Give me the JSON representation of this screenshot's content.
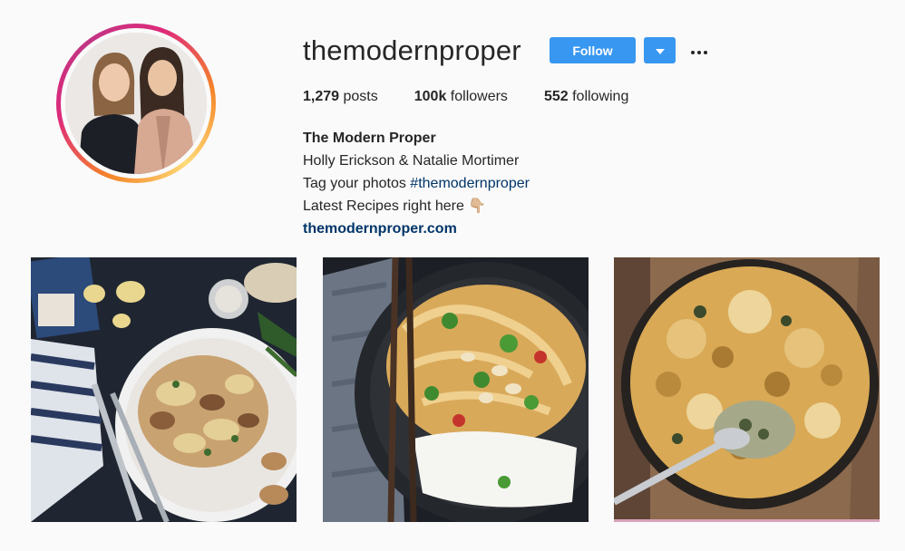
{
  "profile": {
    "username": "themodernproper",
    "follow_label": "Follow",
    "stats": {
      "posts_count": "1,279",
      "posts_label": "posts",
      "followers_count": "100k",
      "followers_label": "followers",
      "following_count": "552",
      "following_label": "following"
    },
    "bio": {
      "name": "The Modern Proper",
      "line1": "Holly Erickson & Natalie Mortimer",
      "line2_prefix": "Tag your photos ",
      "line2_hashtag": "#themodernproper",
      "line3": "Latest Recipes right here 👇🏼",
      "website": "themodernproper.com"
    }
  },
  "icons": {
    "dropdown": "chevron-down-icon",
    "more": "more-options-icon"
  },
  "colors": {
    "accent": "#3897f0",
    "link": "#003569",
    "background": "#fafafa"
  },
  "posts": [
    {
      "image": "tortellini-mushroom-bowl"
    },
    {
      "image": "thai-curry-noodles-rice"
    },
    {
      "image": "spinach-artichoke-dip-skillet"
    }
  ]
}
